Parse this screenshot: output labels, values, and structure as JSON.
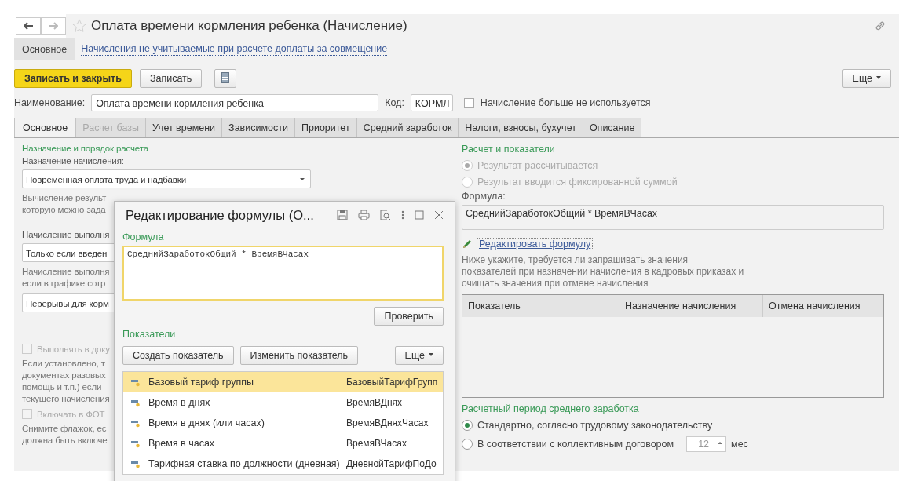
{
  "window": {
    "title": "Оплата времени кормления ребенка (Начисление)"
  },
  "nav_tabs": [
    {
      "label": "Основное",
      "selected": true,
      "kind": "tab"
    },
    {
      "label": "Начисления не учитываемые при расчете доплаты за совмещение",
      "selected": false,
      "kind": "link"
    }
  ],
  "toolbar": {
    "primary": "Записать и закрыть",
    "save": "Записать",
    "more": "Еще"
  },
  "name_row": {
    "label": "Наименование:",
    "value": "Оплата времени кормления ребенка",
    "code_label": "Код:",
    "code": "КОРМЛ",
    "unused_label": "Начисление больше не используется",
    "unused_checked": false
  },
  "tabs": [
    {
      "label": "Основное",
      "selected": true,
      "disabled": false
    },
    {
      "label": "Расчет базы",
      "selected": false,
      "disabled": true
    },
    {
      "label": "Учет времени",
      "selected": false,
      "disabled": false
    },
    {
      "label": "Зависимости",
      "selected": false,
      "disabled": false
    },
    {
      "label": "Приоритет",
      "selected": false,
      "disabled": false
    },
    {
      "label": "Средний заработок",
      "selected": false,
      "disabled": false
    },
    {
      "label": "Налоги, взносы, бухучет",
      "selected": false,
      "disabled": false
    },
    {
      "label": "Описание",
      "selected": false,
      "disabled": false
    }
  ],
  "left": [
    {
      "kind": "section",
      "text": "Назначение и порядок расчета"
    },
    {
      "kind": "label",
      "text": "Назначение начисления:"
    },
    {
      "kind": "select",
      "text": "Повременная оплата труда и надбавки"
    },
    {
      "kind": "note",
      "text": "Вычисление результ\nкоторую можно зада"
    },
    {
      "kind": "label",
      "text": "Начисление выполня"
    },
    {
      "kind": "field",
      "text": "Только если введен"
    },
    {
      "kind": "note",
      "text": "Начисление выполня\nесли в графике сотр"
    },
    {
      "kind": "field",
      "text": "Перерывы для корм"
    },
    {
      "kind": "checkbox",
      "text": "Выполнять в доку",
      "checked": false,
      "disabled": true
    },
    {
      "kind": "note",
      "text": "Если установлено, т\nдокументах разовых\nпомощь и т.п.) если \nтекущего начисления"
    },
    {
      "kind": "checkbox",
      "text": "Включать в ФОТ",
      "checked": false,
      "disabled": true
    },
    {
      "kind": "note",
      "text": "Снимите флажок, ес\nдолжна быть включе"
    }
  ],
  "right": {
    "section": "Расчет и показатели",
    "result_options": [
      {
        "label": "Результат рассчитывается",
        "selected": true,
        "disabled": true
      },
      {
        "label": "Результат вводится фиксированной суммой",
        "selected": false,
        "disabled": true
      }
    ],
    "formula_label": "Формула:",
    "formula": "СреднийЗаработокОбщий * ВремяВЧасах",
    "edit_link": "Редактировать формулу",
    "note": "Ниже укажите, требуется ли запрашивать значения\nпоказателей при назначении начисления в кадровых приказах и\nочищать значения при отмене начисления",
    "table": {
      "columns": [
        "Показатель",
        "Назначение начисления",
        "Отмена начисления"
      ]
    },
    "period_section": "Расчетный период среднего заработка",
    "period_options": [
      {
        "label": "Стандартно, согласно трудовому законодательству",
        "selected": true
      },
      {
        "label": "В соответствии с коллективным договором",
        "selected": false,
        "months": "12",
        "unit": "мес"
      }
    ]
  },
  "dialog": {
    "title": "Редактирование формулы (О...",
    "formula_label": "Формула",
    "formula": "СреднийЗаработокОбщий * ВремяВЧасах",
    "check": "Проверить",
    "indicators_label": "Показатели",
    "create": "Создать показатель",
    "change": "Изменить показатель",
    "more": "Еще",
    "rows": [
      {
        "name": "Базовый тариф группы",
        "code": "БазовыйТарифГрупп",
        "selected": true
      },
      {
        "name": "Время в днях",
        "code": "ВремяВДнях",
        "selected": false
      },
      {
        "name": "Время в днях (или часах)",
        "code": "ВремяВДняхЧасах",
        "selected": false
      },
      {
        "name": "Время в часах",
        "code": "ВремяВЧасах",
        "selected": false
      },
      {
        "name": "Тарифная ставка по должности (дневная)",
        "code": "ДневнойТарифПоДо",
        "selected": false
      }
    ]
  }
}
